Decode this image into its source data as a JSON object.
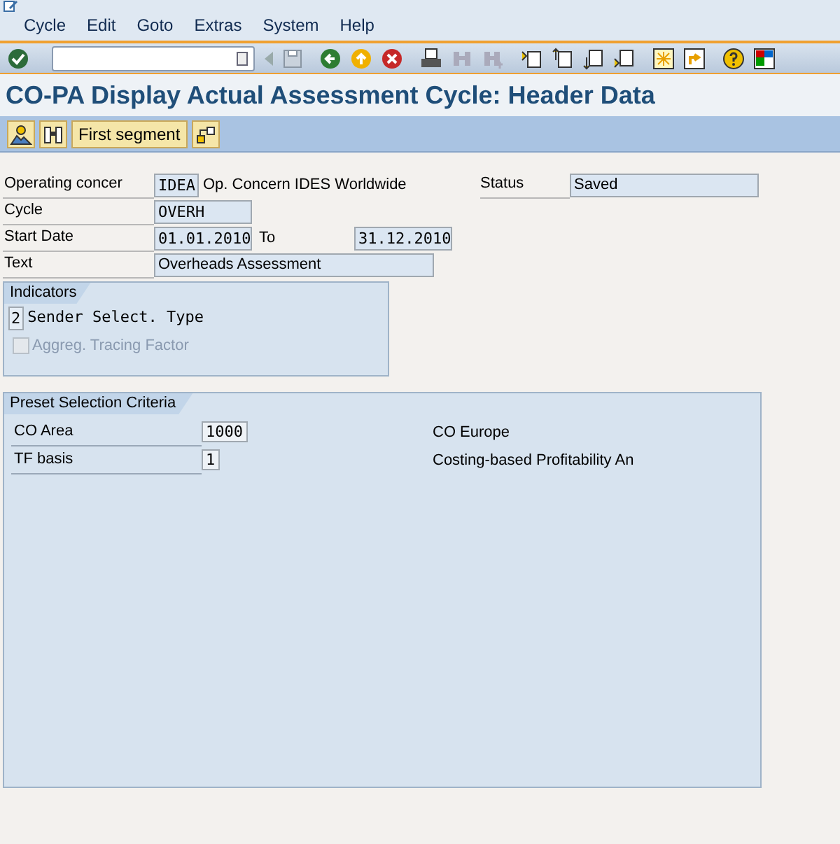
{
  "menu": [
    "Cycle",
    "Edit",
    "Goto",
    "Extras",
    "System",
    "Help"
  ],
  "title": "CO-PA Display Actual Assessment Cycle: Header Data",
  "app_toolbar": {
    "button": "First segment"
  },
  "header": {
    "operating_concern": {
      "label": "Operating concer",
      "value": "IDEA",
      "description": "Op. Concern IDES Worldwide"
    },
    "status": {
      "label": "Status",
      "value": "Saved"
    },
    "cycle": {
      "label": "Cycle",
      "value": "OVERH"
    },
    "start_date": {
      "label": "Start Date",
      "value": "01.01.2010"
    },
    "to": {
      "label": "To",
      "value": "31.12.2010"
    },
    "text": {
      "label": "Text",
      "value": "Overheads Assessment"
    }
  },
  "indicators": {
    "title": "Indicators",
    "sender_select": {
      "value": "2",
      "label": "Sender Select. Type"
    },
    "checkbox": {
      "label": "Aggreg. Tracing Factor",
      "checked": false,
      "disabled": true
    }
  },
  "preset": {
    "title": "Preset Selection Criteria",
    "rows": [
      {
        "label": "CO Area",
        "value": "1000",
        "description": "CO Europe"
      },
      {
        "label": "TF basis",
        "value": "1",
        "description": "Costing-based Profitability An"
      }
    ]
  }
}
